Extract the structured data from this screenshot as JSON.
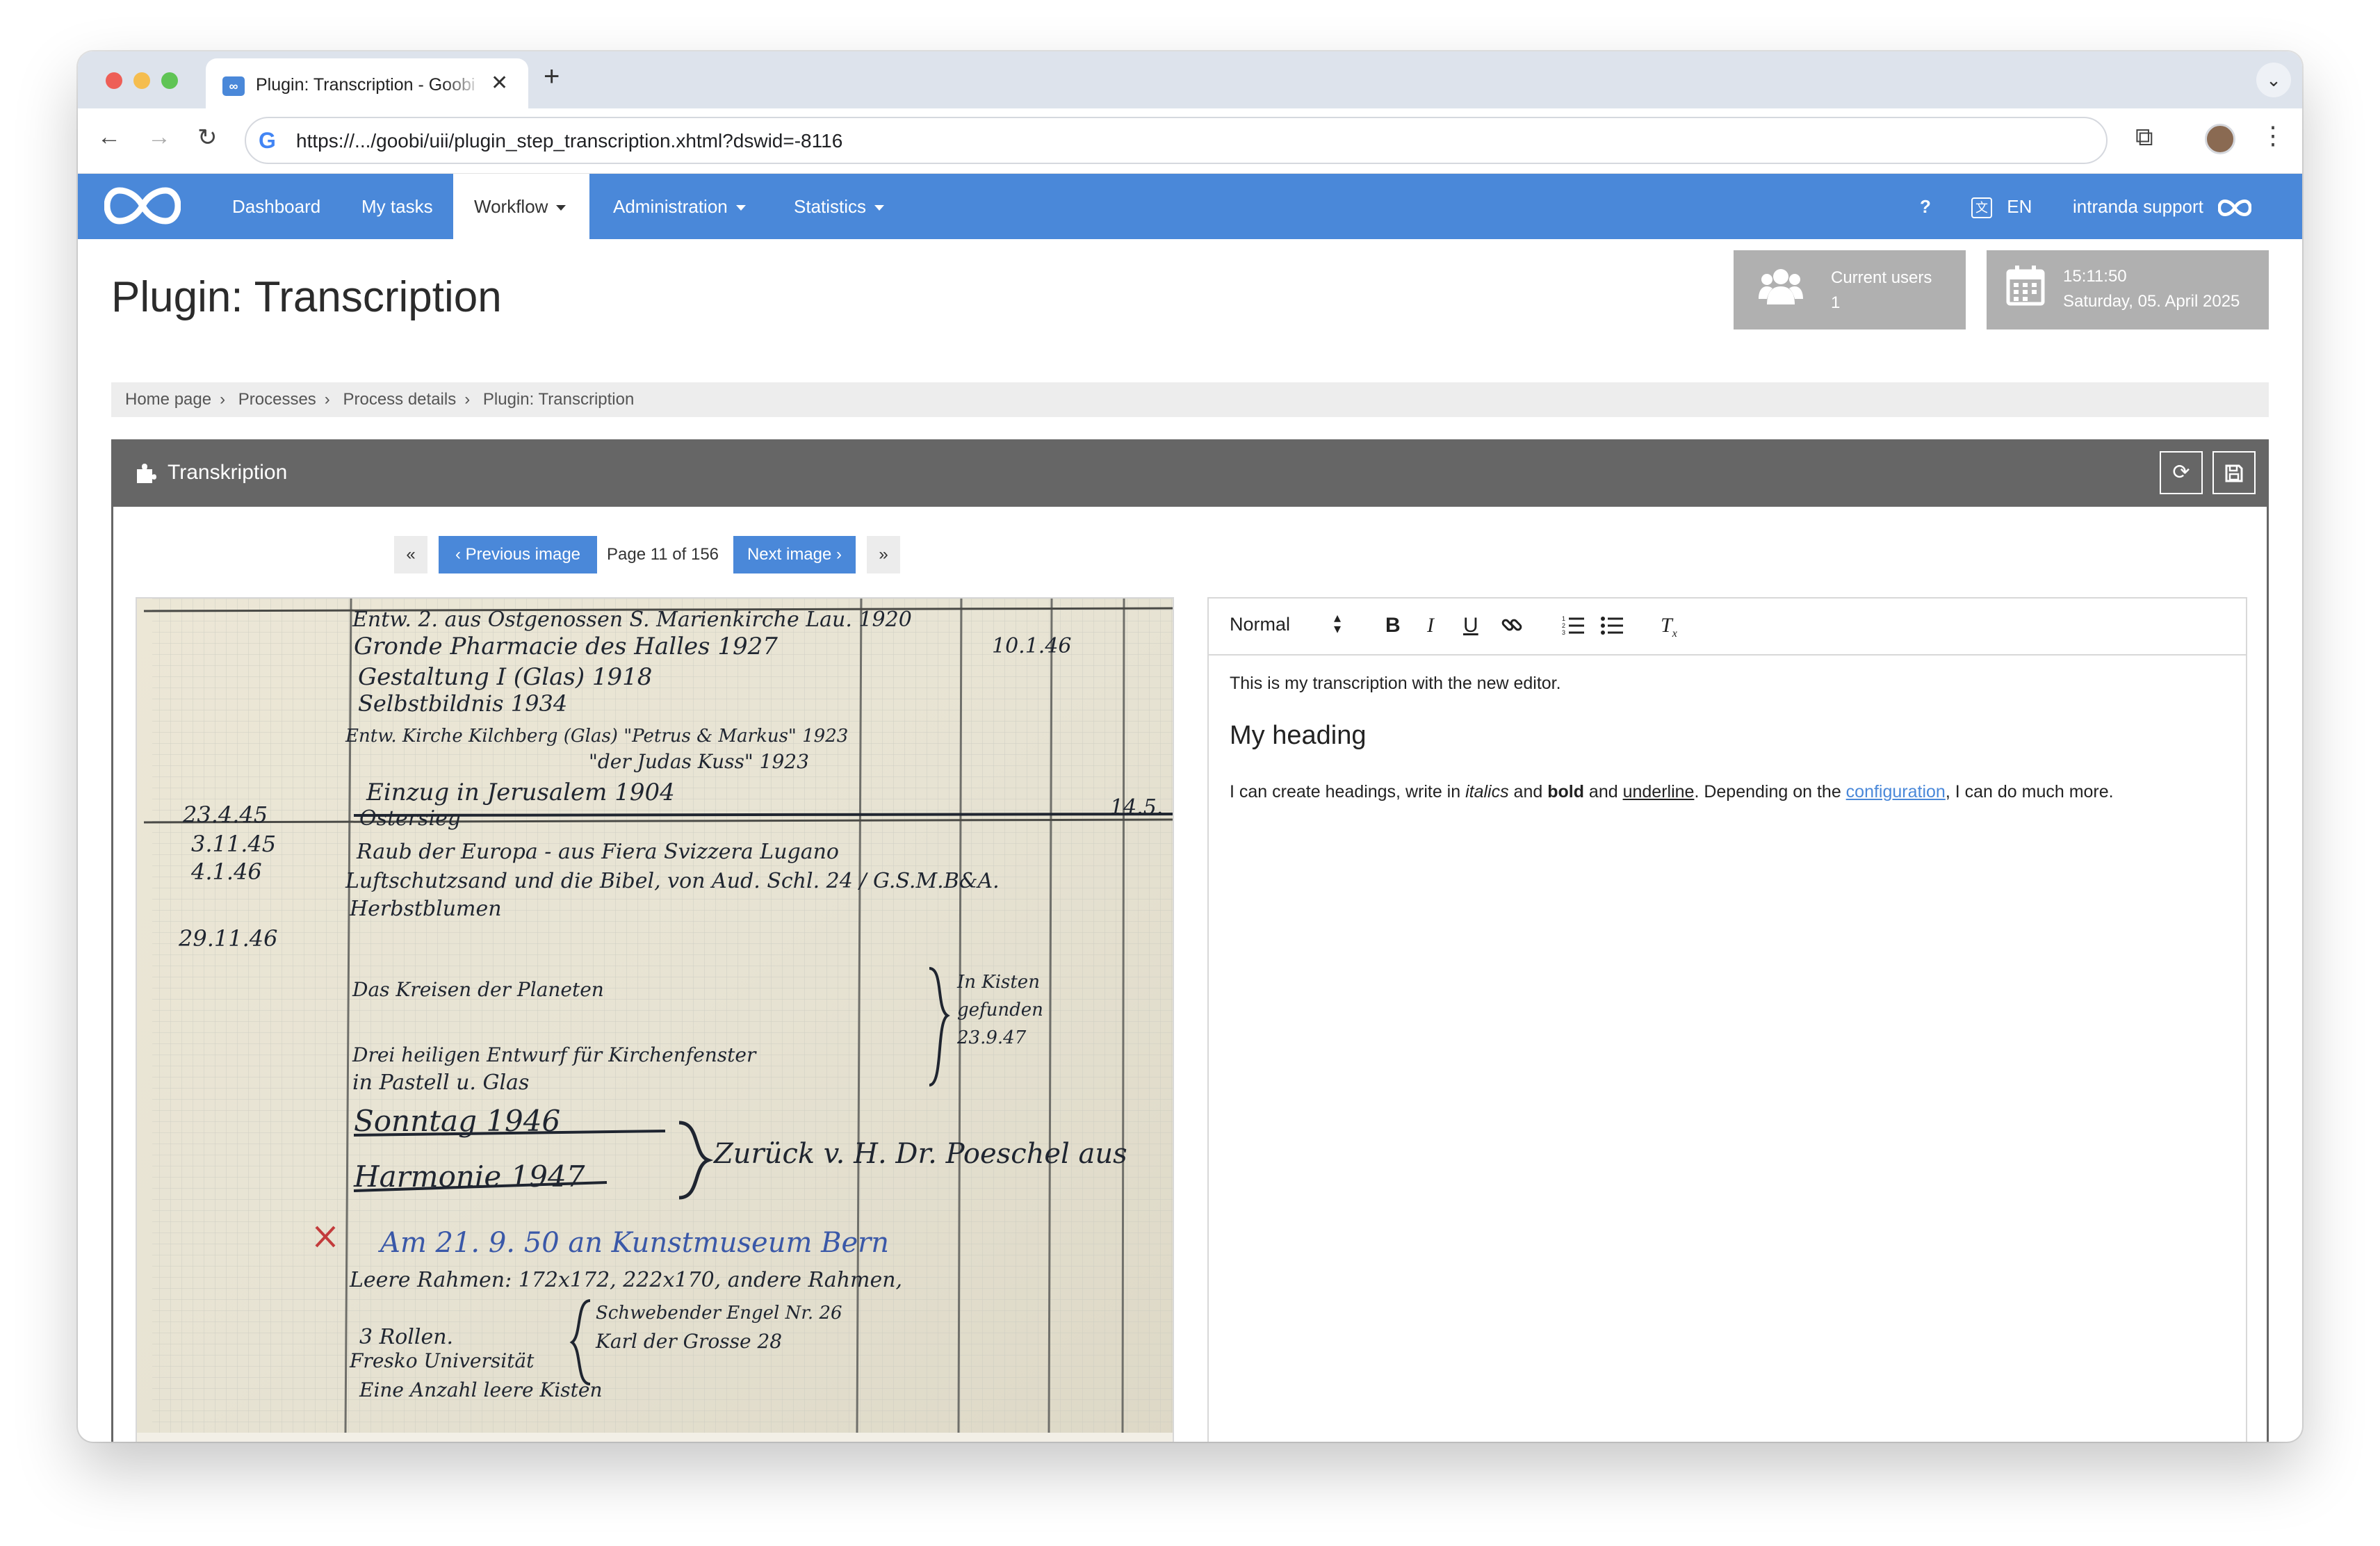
{
  "browser": {
    "tab_title": "Plugin: Transcription - Goobi workflow",
    "favicon_label": "∞",
    "url": "https://.../goobi/uii/plugin_step_transcription.xhtml?dswid=-8116"
  },
  "nav": {
    "items": [
      "Dashboard",
      "My tasks",
      "Workflow",
      "Administration",
      "Statistics"
    ],
    "help": "?",
    "language": "EN",
    "user": "intranda support"
  },
  "page": {
    "title": "Plugin: Transcription",
    "current_users_label": "Current users",
    "current_users_count": "1",
    "time": "15:11:50",
    "date": "Saturday, 05. April 2025"
  },
  "breadcrumb": [
    "Home page",
    "Processes",
    "Process details",
    "Plugin: Transcription"
  ],
  "box": {
    "title": "Transkription"
  },
  "pager": {
    "first": "«",
    "prev": "‹ Previous image",
    "page_info": "Page 11 of 156",
    "next": "Next image ›",
    "last": "»"
  },
  "editor": {
    "format": "Normal",
    "paragraph1": "This is my transcription with the new editor.",
    "heading": "My heading",
    "p2_a": "I can create headings, write in ",
    "p2_italic": "italics",
    "p2_b": " and ",
    "p2_bold": "bold",
    "p2_c": " and ",
    "p2_underline": "underline",
    "p2_d": ". Depending on the ",
    "p2_link": "configuration",
    "p2_e": ", I can do much more."
  },
  "manuscript": {
    "lines": [
      "Entw. 2. aus Ostgenossen S. Marienkirche Lau. 1920",
      "Gronde Pharmacie des Halles   1927",
      "Gestaltung I  (Glas)   1918",
      "Selbstbildnis   1934",
      "Entw. Kirche Kilchberg (Glas) \"Petrus & Markus\" 1923",
      "\"der Judas Kuss\" 1923",
      "Einzug in Jerusalem   1904",
      "Ostersieg",
      "Raub der Europa - aus Fiera Svizzera Lugano",
      "Luftschutzsand und die Bibel, von Aud. Schl. 24 / G.S.M.B&A.",
      "Herbstblumen",
      "Das Kreisen der Planeten",
      "Drei heiligen Entwurf für Kirchenfenster",
      "in Pastell u. Glas",
      "Sonntag 1946",
      "Harmonie 1947",
      "Zurück v. H. Dr. Poeschel aus",
      "Am 21. 9. 50 an Kunstmuseum Bern",
      "Leere Rahmen: 172x172, 222x170, andere Rahmen,",
      "3 Rollen.",
      "Fresko Universität",
      "Schwebender Engel Nr. 26",
      "Karl der Grosse   28",
      "Eine Anzahl leere Kisten"
    ],
    "dates": [
      "23.4.45",
      "3.11.45",
      "4.1.46",
      "29.11.46"
    ],
    "side_dates": [
      "10.1.46",
      "14.5."
    ],
    "note": "In Kisten gefunden 23.9.47"
  }
}
